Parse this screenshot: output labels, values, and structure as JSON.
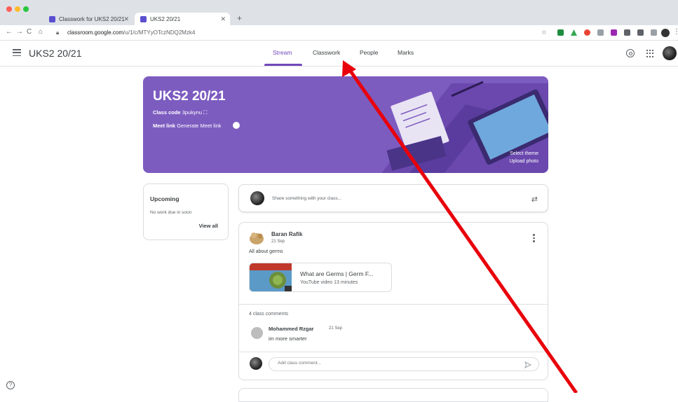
{
  "browser": {
    "tabs": [
      {
        "label": "Classwork for UKS2 20/21"
      },
      {
        "label": "UKS2 20/21"
      }
    ],
    "new_tab_symbol": "+",
    "url_domain": "classroom.google.com",
    "url_path": "/u/1/c/MTYyOTczNDQ2Mzk4"
  },
  "header": {
    "class_title": "UKS2 20/21",
    "tabs": [
      {
        "label": "Stream",
        "active": true
      },
      {
        "label": "Classwork",
        "active": false
      },
      {
        "label": "People",
        "active": false
      },
      {
        "label": "Marks",
        "active": false
      }
    ]
  },
  "banner": {
    "title": "UKS2 20/21",
    "class_code_label": "Class code",
    "class_code": "3pukynu",
    "meet_label": "Meet link",
    "meet_action": "Generate Meet link",
    "select_theme": "Select theme",
    "upload_photo": "Upload photo",
    "color": "#7d5cc0"
  },
  "upcoming": {
    "title": "Upcoming",
    "text": "No work due in soon",
    "view_all": "View all"
  },
  "share": {
    "placeholder": "Share something with your class..."
  },
  "post": {
    "author": "Baran Rafik",
    "date": "21 Sep",
    "body": "All about germs",
    "attachment": {
      "title": "What are Germs | Germ F...",
      "meta": "YouTube video   13 minutes"
    },
    "comments_count": "4 class comments",
    "comment": {
      "author": "Mohammed Rzgar",
      "date": "21 Sep",
      "text": "im more smarter"
    },
    "comment_placeholder": "Add class comment..."
  },
  "icons": {
    "menu": "menu-icon",
    "settings": "gear-icon",
    "apps": "apps-grid-icon",
    "help": "help-icon",
    "send": "send-icon",
    "repost": "repost-icon",
    "more": "more-vert-icon"
  },
  "colors": {
    "accent": "#7248b9",
    "annotation_arrow": "#e8000b"
  }
}
